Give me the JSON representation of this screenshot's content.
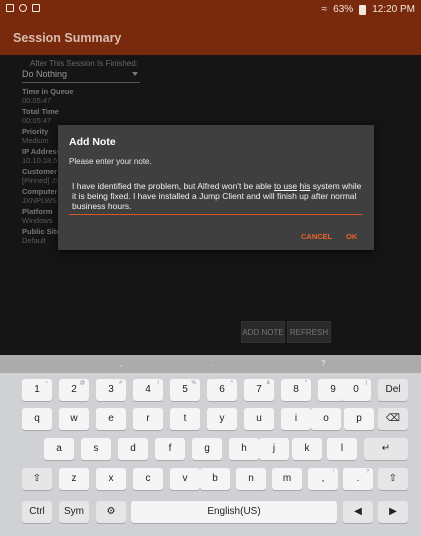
{
  "status": {
    "battery": "63%",
    "time": "12:20 PM"
  },
  "app": {
    "title": "Session Summary"
  },
  "content": {
    "after_label": "After This Session Is Finished:",
    "after_value": "Do Nothing",
    "fields": [
      {
        "label": "Time in Queue",
        "value": "00:05:47"
      },
      {
        "label": "Total Time",
        "value": "00:05:47"
      },
      {
        "label": "Priority",
        "value": "Medium"
      },
      {
        "label": "IP Address",
        "value": "10.10.18.59"
      },
      {
        "label": "Customer",
        "value": "[Pinned] JX"
      },
      {
        "label": "Computer",
        "value": "JXNPLWS"
      },
      {
        "label": "Platform",
        "value": "Windows"
      },
      {
        "label": "Public Site",
        "value": "Default"
      }
    ],
    "add_note_button": "ADD NOTE",
    "refresh_button": "REFRESH"
  },
  "dialog": {
    "title": "Add Note",
    "prompt": "Please enter your note.",
    "note_part1": "I have identified the problem, but Alfred won't be able ",
    "note_link1": "to use",
    "note_mid": " ",
    "note_link2": "his",
    "note_part2": " system while it is being fixed. I have installed a Jump Client and will finish up after normal business hours.",
    "cancel_label": "CANCEL",
    "ok_label": "OK"
  },
  "keyboard": {
    "suggestions": [
      ",",
      ".",
      "?"
    ],
    "row1": [
      {
        "main": "1",
        "sup": "~"
      },
      {
        "main": "2",
        "sup": "@"
      },
      {
        "main": "3",
        "sup": "#"
      },
      {
        "main": "4",
        "sup": "/"
      },
      {
        "main": "5",
        "sup": "%"
      },
      {
        "main": "6",
        "sup": "^"
      },
      {
        "main": "7",
        "sup": "&"
      },
      {
        "main": "8",
        "sup": "*"
      },
      {
        "main": "9",
        "sup": "("
      },
      {
        "main": "0",
        "sup": ")"
      }
    ],
    "del_label": "Del",
    "row2": [
      "q",
      "w",
      "e",
      "r",
      "t",
      "y",
      "u",
      "i",
      "o",
      "p"
    ],
    "row3": [
      "a",
      "s",
      "d",
      "f",
      "g",
      "h",
      "j",
      "k",
      "l"
    ],
    "row4": [
      "z",
      "x",
      "c",
      "v",
      "b",
      "n",
      "m"
    ],
    "row4_punct": [
      {
        "main": ",",
        "sup": "!"
      },
      {
        "main": ".",
        "sup": "?"
      }
    ],
    "ctrl_label": "Ctrl",
    "sym_label": "Sym",
    "space_label": "English(US)"
  }
}
